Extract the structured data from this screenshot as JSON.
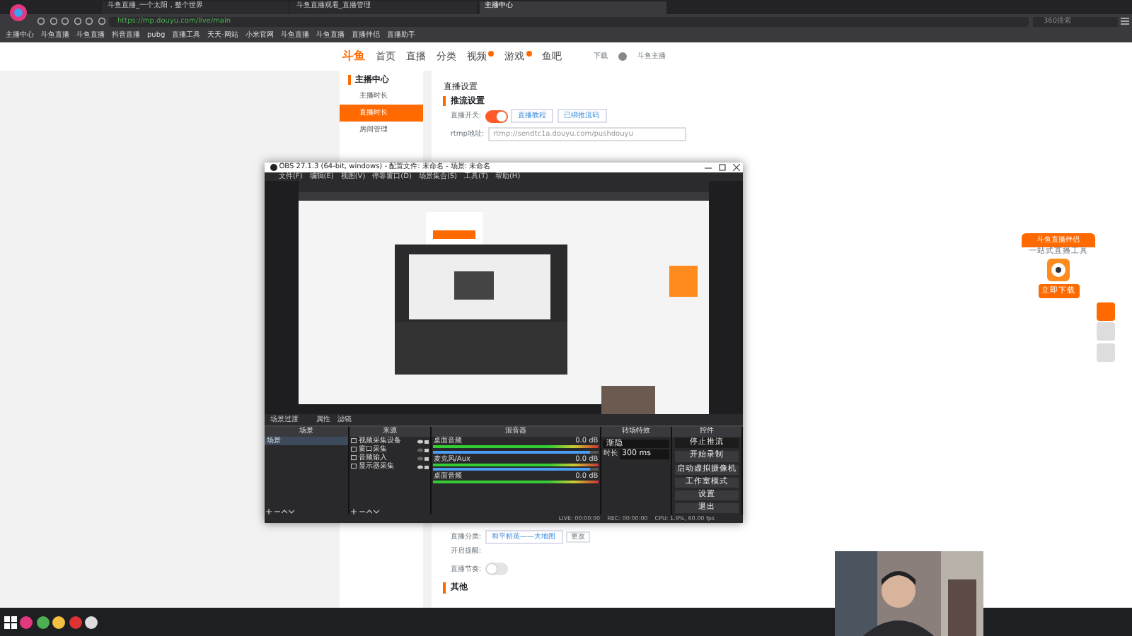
{
  "browser": {
    "tabs": [
      {
        "title": "斗鱼直播_一个太阳，整个世界",
        "selected": false
      },
      {
        "title": "斗鱼直播观看_直播管理",
        "selected": false
      },
      {
        "title": "主播中心",
        "selected": true
      }
    ],
    "url": "https://mp.douyu.com/live/main",
    "bookmarks": [
      "主播中心",
      "斗鱼直播",
      "斗鱼直播",
      "抖音直播",
      "pubg",
      "直播工具",
      "天天·网站",
      "小米官网",
      "斗鱼直播",
      "斗鱼直播",
      "直播伴侣",
      "直播助手"
    ],
    "search_placeholder": "360搜索"
  },
  "site": {
    "logo": "斗鱼",
    "nav": [
      {
        "label": "首页",
        "badge": false
      },
      {
        "label": "直播",
        "badge": false
      },
      {
        "label": "分类",
        "badge": false
      },
      {
        "label": "视频",
        "badge": true
      },
      {
        "label": "游戏",
        "badge": true
      },
      {
        "label": "鱼吧",
        "badge": false
      }
    ],
    "download": "下载",
    "user": "斗鱼主播"
  },
  "sidebar": {
    "title": "主播中心",
    "items": [
      {
        "label": "主播时长",
        "selected": false
      },
      {
        "label": "直播时长",
        "selected": true
      },
      {
        "label": "房间管理",
        "selected": false
      }
    ]
  },
  "content": {
    "title": "直播设置",
    "section": "推流设置",
    "switch_label": "直播开关:",
    "switch_on": true,
    "links": [
      "直播教程",
      "已绑推流码"
    ],
    "rtmp_label": "rtmp地址:",
    "rtmp_value": "rtmp://sendtc1a.douyu.com/pushdouyu",
    "category_label": "直播分类:",
    "category_value": "和平精英——大地图",
    "change_button": "更改",
    "remind_label": "开启提醒:",
    "notify_label": "直播节奏:",
    "notify_on": false,
    "other": "其他"
  },
  "obs": {
    "title": "OBS 27.1.3 (64-bit, windows) - 配置文件: 未命名 - 场景: 未命名",
    "menu": [
      "文件(F)",
      "编辑(E)",
      "视图(V)",
      "停靠窗口(D)",
      "场景集合(S)",
      "工具(T)",
      "帮助(H)"
    ],
    "toolbar": [
      "场景过渡",
      "属性",
      "滤镜"
    ],
    "docks": [
      "场景",
      "来源",
      "混音器",
      "转场特效",
      "控件"
    ],
    "scenes": [
      {
        "label": "场景",
        "selected": true
      }
    ],
    "sources": [
      {
        "label": "视频采集设备",
        "visible": true
      },
      {
        "label": "窗口采集",
        "visible": false
      },
      {
        "label": "音频输入",
        "visible": false
      },
      {
        "label": "显示器采集",
        "visible": true
      }
    ],
    "mixer": [
      {
        "name": "桌面音频",
        "reading": "0.0 dB",
        "level": 0.95
      },
      {
        "name": "麦克风/Aux",
        "reading": "0.0 dB",
        "level": 0.95
      },
      {
        "name": "桌面音频",
        "reading": "0.0 dB"
      }
    ],
    "transition": {
      "value": "渐隐",
      "duration_label": "时长",
      "duration": "300 ms"
    },
    "controls": [
      {
        "label": "停止推流",
        "active": true
      },
      {
        "label": "开始录制",
        "active": false
      },
      {
        "label": "启动虚拟摄像机",
        "active": false
      },
      {
        "label": "工作室模式",
        "active": false
      },
      {
        "label": "设置",
        "active": false
      },
      {
        "label": "退出",
        "active": false
      }
    ],
    "status": [
      "LIVE: 00:00:00",
      "REC: 00:00:00",
      "CPU: 1.9%, 60.00 fps"
    ]
  },
  "widget": {
    "title": "斗鱼直播伴侣",
    "subtitle": "一站式直播工具",
    "button": "立即下载"
  }
}
